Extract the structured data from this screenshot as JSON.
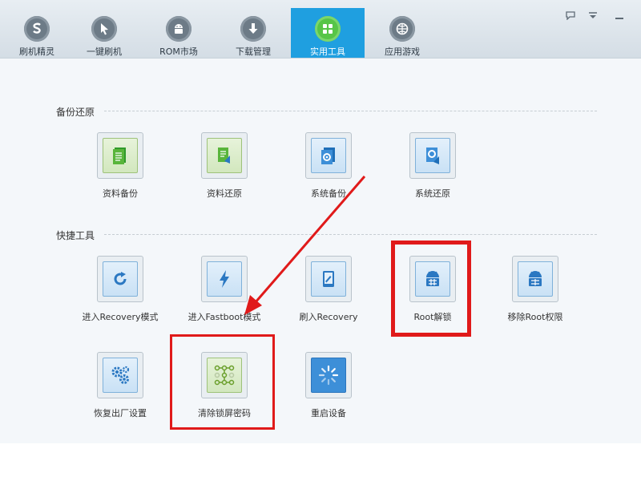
{
  "nav": {
    "tabs": [
      {
        "label": "刷机精灵",
        "icon": "s-logo-icon"
      },
      {
        "label": "一键刷机",
        "icon": "cursor-icon"
      },
      {
        "label": "ROM市场",
        "icon": "android-icon"
      },
      {
        "label": "下载管理",
        "icon": "download-icon"
      },
      {
        "label": "实用工具",
        "icon": "toolbox-icon",
        "active": true
      },
      {
        "label": "应用游戏",
        "icon": "ball-icon"
      }
    ],
    "controls": [
      "feedback-icon",
      "menu-icon",
      "minimize-icon"
    ]
  },
  "sections": {
    "backup": {
      "title": "备份还原",
      "items": [
        {
          "label": "资料备份"
        },
        {
          "label": "资料还原"
        },
        {
          "label": "系统备份"
        },
        {
          "label": "系统还原"
        }
      ]
    },
    "quick": {
      "title": "快捷工具",
      "items": [
        {
          "label": "进入Recovery模式"
        },
        {
          "label": "进入Fastboot模式"
        },
        {
          "label": "刷入Recovery"
        },
        {
          "label": "Root解锁"
        },
        {
          "label": "移除Root权限"
        },
        {
          "label": "恢复出厂设置"
        },
        {
          "label": "清除锁屏密码"
        },
        {
          "label": "重启设备"
        }
      ]
    }
  },
  "annotation": {
    "highlight_color": "#e01a1a"
  }
}
